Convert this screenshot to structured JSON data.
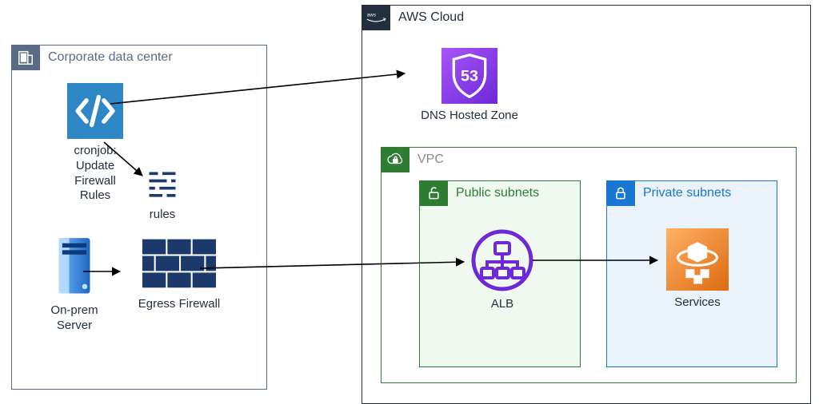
{
  "groups": {
    "corp": {
      "title": "Corporate data center"
    },
    "aws": {
      "title": "AWS Cloud"
    },
    "vpc": {
      "title": "VPC"
    },
    "public": {
      "title": "Public subnets"
    },
    "private": {
      "title": "Private subnets"
    }
  },
  "nodes": {
    "cronjob": {
      "label": "cronjob:\nUpdate\nFirewall\nRules"
    },
    "rules": {
      "label": "rules"
    },
    "server": {
      "label": "On-prem\nServer"
    },
    "firewall": {
      "label": "Egress Firewall"
    },
    "route53": {
      "label": "DNS Hosted Zone"
    },
    "alb": {
      "label": "ALB"
    },
    "services": {
      "label": "Services"
    }
  },
  "arrows": [
    [
      "cronjob",
      "route53"
    ],
    [
      "cronjob",
      "rules"
    ],
    [
      "server",
      "firewall"
    ],
    [
      "firewall",
      "alb"
    ],
    [
      "alb",
      "services"
    ]
  ],
  "colors": {
    "corp": "#5a6b86",
    "aws": "#232f3e",
    "vpc_green": "#2e7d32",
    "private_blue": "#1976d2",
    "route53_purple": "#7c3aed",
    "alb_purple": "#6d28d9",
    "ecs_orange": "#ed7100",
    "firewall_navy": "#1b3a6b",
    "code_blue": "#2f86c5",
    "server_blue": "#2a7bd1"
  }
}
